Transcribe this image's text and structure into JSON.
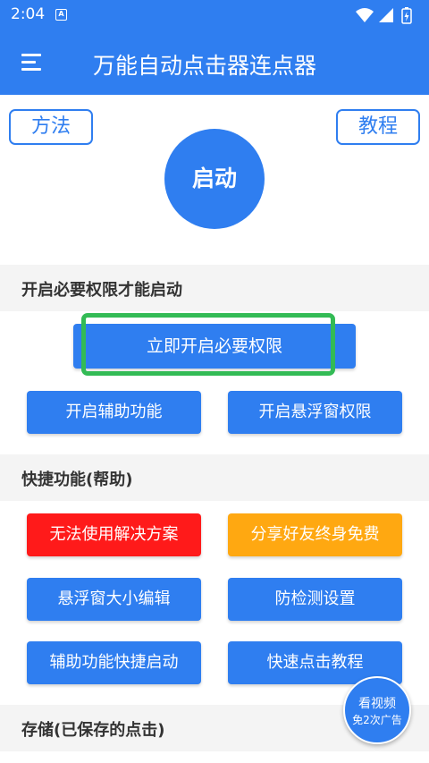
{
  "status_bar": {
    "time": "2:04",
    "app_icon_glyph": "A",
    "icons": [
      "wifi-icon",
      "signal-icon",
      "battery-icon"
    ]
  },
  "app_bar": {
    "title": "万能自动点击器连点器"
  },
  "top_buttons": {
    "method_label": "方法",
    "tutorial_label": "教程"
  },
  "start_button": {
    "label": "启动"
  },
  "permissions_section": {
    "header": "开启必要权限才能启动",
    "enable_all_label": "立即开启必要权限",
    "accessibility_label": "开启辅助功能",
    "overlay_label": "开启悬浮窗权限"
  },
  "shortcuts_section": {
    "header": "快捷功能(帮助)",
    "buttons": [
      {
        "label": "无法使用解决方案",
        "color": "#ff1a1a"
      },
      {
        "label": "分享好友终身免费",
        "color": "#ffa811"
      },
      {
        "label": "悬浮窗大小编辑",
        "color": "#2f7ef0"
      },
      {
        "label": "防检测设置",
        "color": "#2f7ef0"
      },
      {
        "label": "辅助功能快捷启动",
        "color": "#2f7ef0"
      },
      {
        "label": "快速点击教程",
        "color": "#2f7ef0"
      }
    ]
  },
  "storage_section": {
    "header": "存储(已保存的点击)"
  },
  "float_video": {
    "line1": "看视频",
    "line2": "免2次广告"
  },
  "colors": {
    "primary": "#2f7ef0",
    "highlight": "#33bb55"
  }
}
